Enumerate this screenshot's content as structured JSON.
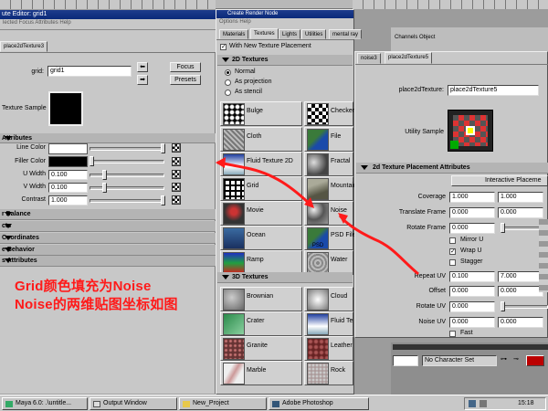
{
  "attr_editor": {
    "title": "ute Editor: grid1",
    "menu": "lected  Focus  Attributes  Help",
    "tab": "place2dTexture3",
    "grid_label": "grid:",
    "grid_value": "grid1",
    "focus_label": "Focus",
    "presets_label": "Presets",
    "texture_sample_label": "Texture Sample",
    "section_attributes": "Attributes",
    "line_color_label": "Line Color",
    "filler_color_label": "Filler Color",
    "u_width_label": "U Width",
    "u_width_value": "0.100",
    "v_width_label": "V Width",
    "v_width_value": "0.100",
    "contrast_label": "Contrast",
    "contrast_value": "1.000",
    "collapsed_sections": [
      "r Balance",
      "cts",
      "Coordinates",
      "e Behavior",
      "s Attributes"
    ]
  },
  "render_node": {
    "title": "Create Render Node",
    "menu": "Options  Help",
    "tabs": [
      "Materials",
      "Textures",
      "Lights",
      "Utilities",
      "mental ray"
    ],
    "with_placement_label": "With New Texture Placement",
    "section_2d": "2D Textures",
    "radio_normal": "Normal",
    "radio_projection": "As projection",
    "radio_stencil": "As stencil",
    "textures_2d": [
      "Bulge",
      "Checker",
      "Cloth",
      "File",
      "Fluid Texture 2D",
      "Fractal",
      "Grid",
      "Mountain",
      "Movie",
      "Noise",
      "Ocean",
      "PSD File",
      "Ramp",
      "Water"
    ],
    "psd_label": "PSD",
    "section_3d": "3D Textures",
    "textures_3d": [
      "Brownian",
      "Cloud",
      "Crater",
      "Fluid Te",
      "Granite",
      "Leather",
      "Marble",
      "Rock"
    ]
  },
  "place2d_editor": {
    "tab_other": "noise3",
    "tab_active": "place2dTexture5",
    "name_label": "place2dTexture:",
    "name_value": "place2dTexture5",
    "utility_sample_label": "Utility Sample",
    "section_title": "2d Texture Placement Attributes",
    "interactive_button": "Interactive Placeme",
    "coverage_label": "Coverage",
    "coverage_values": [
      "1.000",
      "1.000"
    ],
    "translate_label": "Translate Frame",
    "translate_values": [
      "0.000",
      "0.000"
    ],
    "rotate_frame_label": "Rotate Frame",
    "rotate_frame_value": "0.000",
    "mirror_u": "Mirror U",
    "wrap_u": "Wrap U",
    "stagger": "Stagger",
    "repeat_label": "Repeat UV",
    "repeat_values": [
      "0.100",
      "7.000"
    ],
    "offset_label": "Offset",
    "offset_values": [
      "0.000",
      "0.000"
    ],
    "rotate_uv_label": "Rotate UV",
    "rotate_uv_value": "0.000",
    "noise_uv_label": "Noise UV",
    "noise_uv_values": [
      "0.000",
      "0.000"
    ],
    "fast_label": "Fast",
    "char_set_label": "No Character Set"
  },
  "channels_panel": {
    "menu": "Channels Object"
  },
  "annotation": {
    "line1": "Grid颜色填充为Noise",
    "line2": "Noise的两维贴图坐标如图",
    "color": "#ff1a1a"
  },
  "taskbar": {
    "items": [
      "Maya 6.0: .\\untitle...",
      "Output Window",
      "New_Project",
      "Adobe Photoshop"
    ],
    "clock": "15:18"
  }
}
